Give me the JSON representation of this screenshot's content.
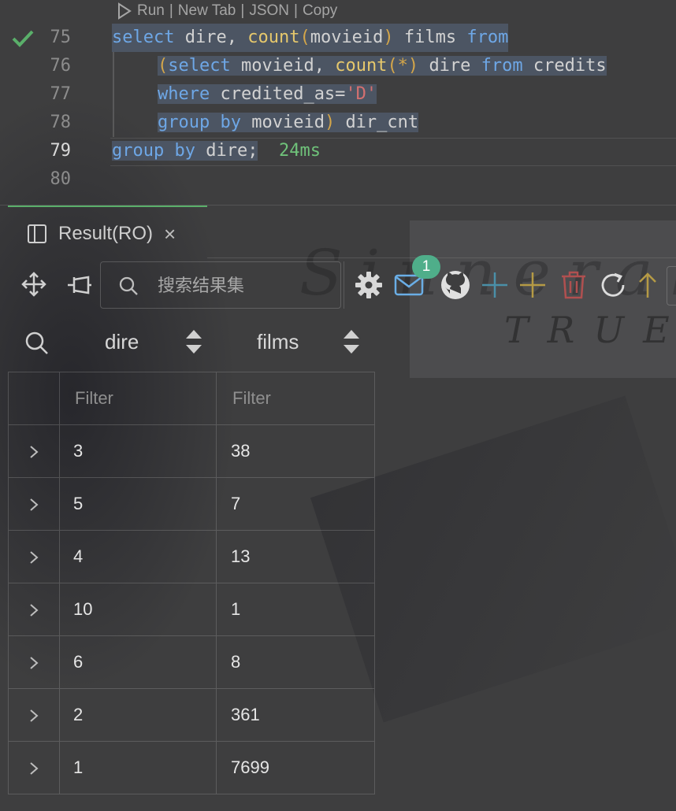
{
  "codelens": {
    "run": "Run",
    "new_tab": "New Tab",
    "json": "JSON",
    "copy": "Copy",
    "separator": "|"
  },
  "editor": {
    "lines": [
      {
        "num": "75",
        "tokens": [
          "select",
          "dire,",
          "count",
          "(",
          "movieid",
          ")",
          "films",
          "from"
        ]
      },
      {
        "num": "76",
        "tokens": [
          "(",
          "select",
          "movieid,",
          "count",
          "(*)",
          "dire",
          "from",
          "credits"
        ]
      },
      {
        "num": "77",
        "tokens": [
          "where",
          "credited_as=",
          "'D'"
        ]
      },
      {
        "num": "78",
        "tokens": [
          "group by",
          "movieid",
          ")",
          "dir_cnt"
        ]
      },
      {
        "num": "79",
        "tokens": [
          "group by",
          "dire;"
        ],
        "timing": "24ms"
      },
      {
        "num": "80",
        "tokens": []
      }
    ]
  },
  "result_tab": {
    "label": "Result(RO)",
    "close": "×"
  },
  "toolbar": {
    "search_placeholder": "搜索结果集",
    "notification_count": "1",
    "icons": [
      "move-icon",
      "pin-icon",
      "search-icon",
      "gear-icon",
      "mail-icon",
      "github-icon",
      "add-row-icon",
      "add-column-icon",
      "trash-icon",
      "refresh-icon",
      "arrow-up-icon"
    ],
    "colors": {
      "add_row": "#4a8fa8",
      "add_column": "#b59a45",
      "trash": "#b05050",
      "badge": "#4fae8a",
      "arrow_up": "#b59a45"
    }
  },
  "columns": [
    {
      "name": "dire"
    },
    {
      "name": "films"
    }
  ],
  "filter_placeholder": "Filter",
  "rows": [
    {
      "dire": "3",
      "films": "38"
    },
    {
      "dire": "5",
      "films": "7"
    },
    {
      "dire": "4",
      "films": "13"
    },
    {
      "dire": "10",
      "films": "1"
    },
    {
      "dire": "6",
      "films": "8"
    },
    {
      "dire": "2",
      "films": "361"
    },
    {
      "dire": "1",
      "films": "7699"
    }
  ]
}
